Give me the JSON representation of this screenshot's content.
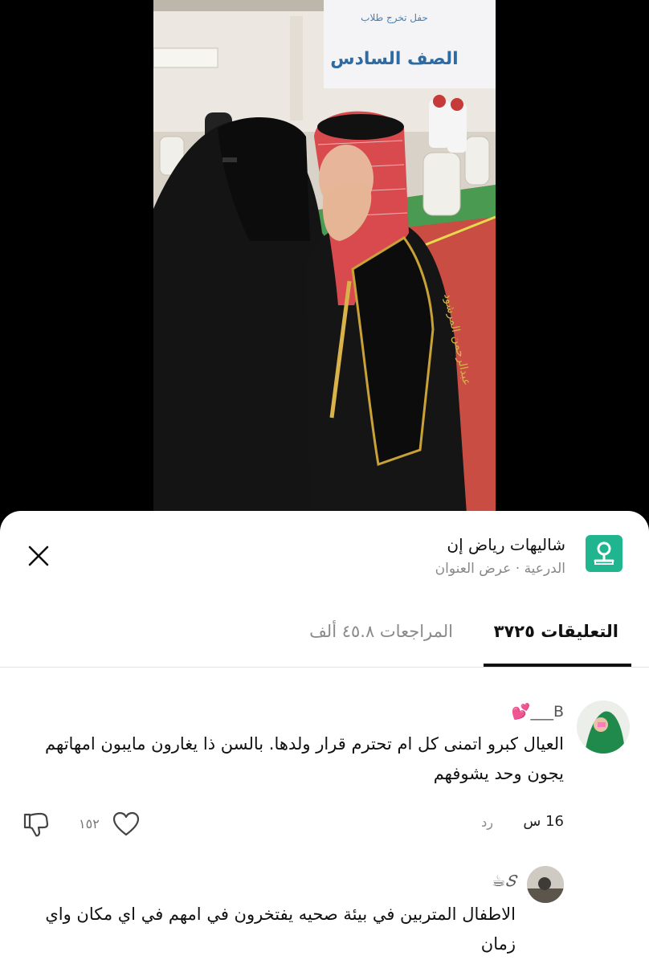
{
  "video": {
    "banner_line1": "حفل تخرج طلاب",
    "banner_line2": "الصف السادس",
    "sash_text": "عبدالرحمن المرشود"
  },
  "place": {
    "name": "شاليهات رياض إن",
    "location": "الدرعية",
    "separator": " · ",
    "view_address": "عرض العنوان",
    "icon": "map-pin-icon",
    "accent_color": "#1fb58f"
  },
  "tabs": [
    {
      "label": "التعليقات ٣٧٢٥",
      "active": true
    },
    {
      "label": "المراجعات ٤٥.٨ ألف",
      "active": false
    }
  ],
  "comments": [
    {
      "username": "💕___B",
      "text": "العيال كبرو اتمنى كل ام تحترم قرار ولدها. بالسن ذا يغارون مايبون امهاتهم يجون وحد يشوفهم",
      "time": "16 س",
      "reply": "رد",
      "likes": "١٥٢"
    },
    {
      "username": "☕𝑆",
      "text": "الاطفال المتربين في بيئة صحيه يفتخرون في امهم في اي مكان واي زمان"
    }
  ]
}
